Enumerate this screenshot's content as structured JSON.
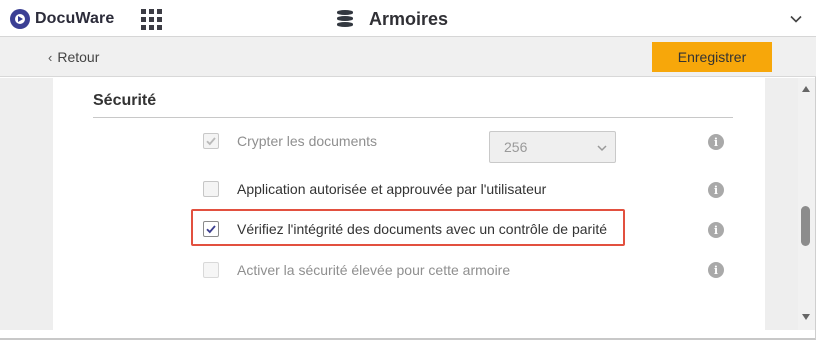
{
  "app": {
    "logo_text": "DocuWare",
    "title": "Armoires"
  },
  "toolbar": {
    "back_label": "Retour",
    "save_label": "Enregistrer"
  },
  "section": {
    "title": "Sécurité",
    "rows": [
      {
        "label": "Crypter les documents",
        "checked": true,
        "disabled": true,
        "has_select": true
      },
      {
        "label": "Application autorisée et approuvée par l'utilisateur",
        "checked": false,
        "disabled": false
      },
      {
        "label": "Vérifiez l'intégrité des documents avec un contrôle de parité",
        "checked": true,
        "disabled": false,
        "highlighted": true
      },
      {
        "label": "Activer la sécurité élevée pour cette armoire",
        "checked": false,
        "disabled": true
      }
    ],
    "encryption_select": {
      "value": "256"
    }
  },
  "icons": {
    "logo": "docuware-logo-icon",
    "apps": "apps-grid-icon",
    "database": "database-icon",
    "collapse": "chevron-down-icon",
    "back": "chevron-left-icon",
    "info": "info-icon",
    "check": "checkmark-icon"
  },
  "colors": {
    "brand": "#3b3f94",
    "save_button": "#f7a70a",
    "highlight_border": "#e2503f",
    "check_accent": "#3d3f8f"
  }
}
